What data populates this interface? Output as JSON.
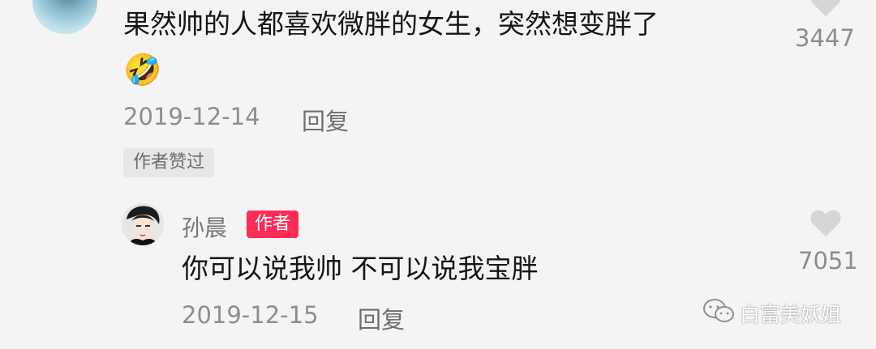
{
  "top_comment": {
    "text_line1": "果然帅的人都喜欢微胖的女生，突然想变胖了",
    "emoji": "🤣",
    "date": "2019-12-14",
    "reply_label": "回复",
    "liked_by_author_tag": "作者赞过",
    "like_count": "3447"
  },
  "reply_comment": {
    "author": "孙晨",
    "author_badge": "作者",
    "text": "你可以说我帅 不可以说我宝胖",
    "date": "2019-12-15",
    "reply_label": "回复",
    "like_count": "7051"
  },
  "watermark": {
    "icon": "wechat-icon",
    "text": "白富美妖姐"
  },
  "colors": {
    "background": "#f4f4f4",
    "author_badge": "#ff2c55",
    "heart": "#d6d6d6"
  }
}
